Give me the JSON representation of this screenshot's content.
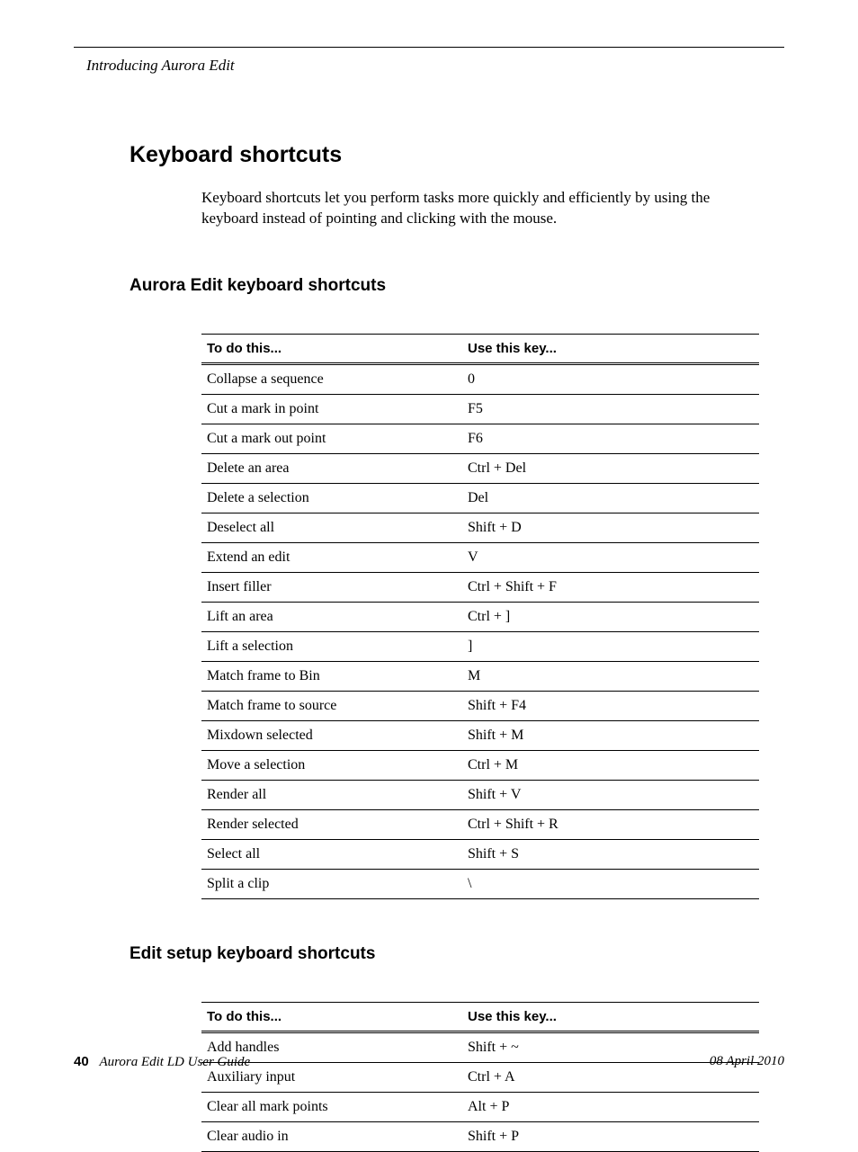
{
  "runningHead": "Introducing Aurora Edit",
  "title": "Keyboard shortcuts",
  "intro": "Keyboard shortcuts let you perform tasks more quickly and efficiently by using the keyboard instead of pointing and clicking with the mouse.",
  "section1": {
    "heading": "Aurora Edit keyboard shortcuts",
    "col1": "To do this...",
    "col2": "Use this key...",
    "rows": [
      {
        "action": "Collapse a sequence",
        "key": "0"
      },
      {
        "action": "Cut a mark in point",
        "key": "F5"
      },
      {
        "action": "Cut a mark out point",
        "key": "F6"
      },
      {
        "action": "Delete an area",
        "key": "Ctrl + Del"
      },
      {
        "action": "Delete a selection",
        "key": "Del"
      },
      {
        "action": "Deselect all",
        "key": "Shift + D"
      },
      {
        "action": "Extend an edit",
        "key": "V"
      },
      {
        "action": "Insert filler",
        "key": "Ctrl + Shift + F"
      },
      {
        "action": "Lift an area",
        "key": "Ctrl + ]"
      },
      {
        "action": "Lift a selection",
        "key": "]"
      },
      {
        "action": "Match frame to Bin",
        "key": "M"
      },
      {
        "action": "Match frame to source",
        "key": "Shift + F4"
      },
      {
        "action": "Mixdown selected",
        "key": "Shift + M"
      },
      {
        "action": "Move a selection",
        "key": "Ctrl + M"
      },
      {
        "action": "Render all",
        "key": "Shift + V"
      },
      {
        "action": "Render selected",
        "key": "Ctrl + Shift + R"
      },
      {
        "action": "Select all",
        "key": "Shift + S"
      },
      {
        "action": "Split a clip",
        "key": "\\"
      }
    ]
  },
  "section2": {
    "heading": "Edit setup keyboard shortcuts",
    "col1": "To do this...",
    "col2": "Use this key...",
    "rows": [
      {
        "action": "Add handles",
        "key": "Shift + ~"
      },
      {
        "action": "Auxiliary input",
        "key": "Ctrl + A"
      },
      {
        "action": "Clear all mark points",
        "key": "Alt + P"
      },
      {
        "action": "Clear audio in",
        "key": "Shift + P"
      }
    ]
  },
  "footer": {
    "pageNum": "40",
    "guide": "Aurora Edit LD User Guide",
    "date": "08 April 2010"
  }
}
